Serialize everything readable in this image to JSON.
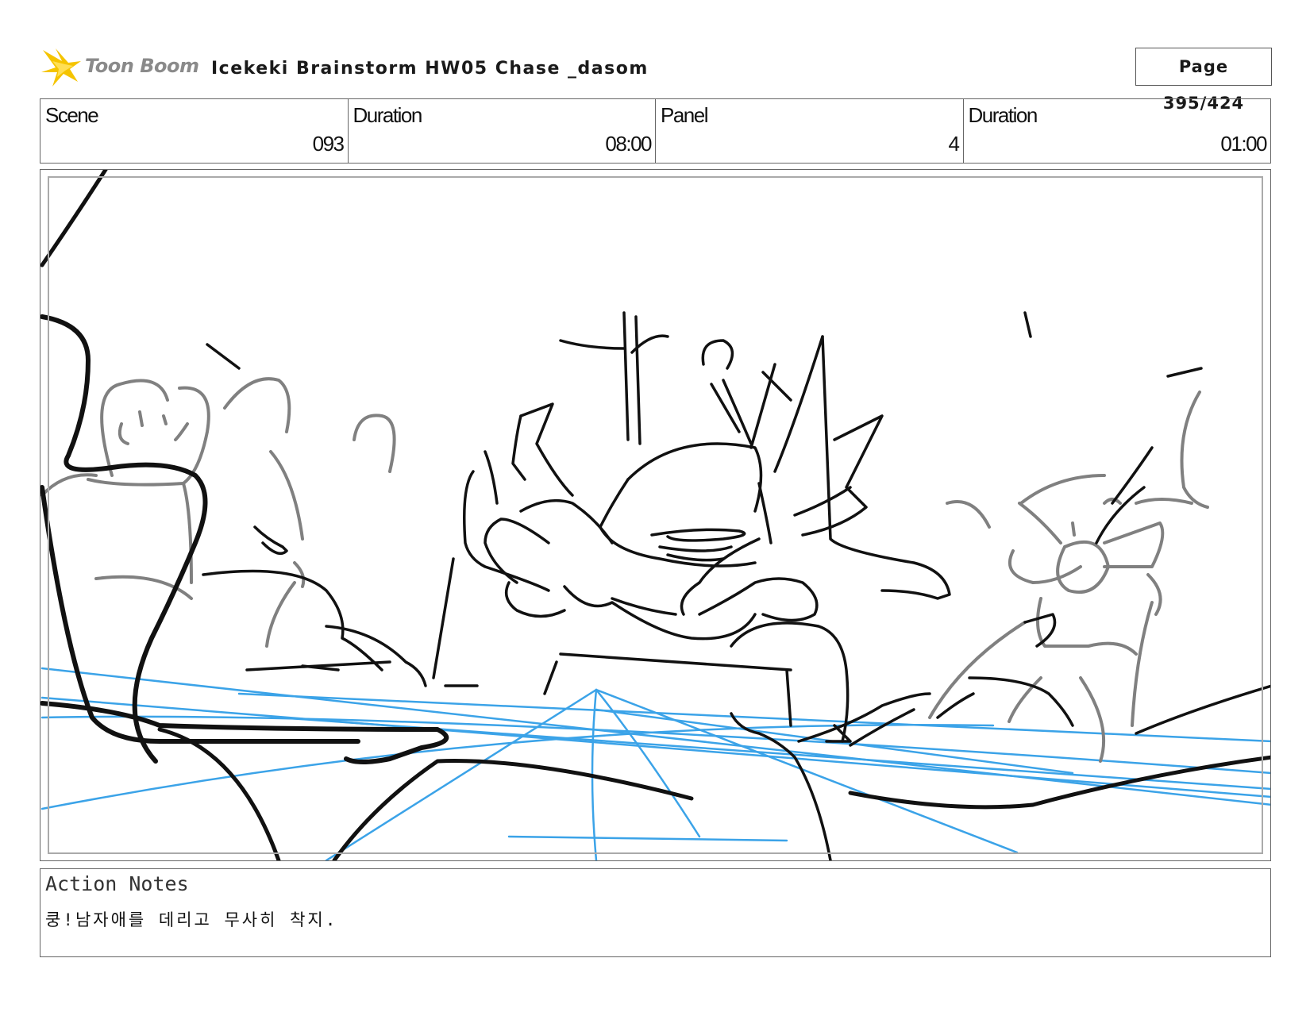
{
  "header": {
    "logo_text": "Toon Boom",
    "project_title": "Icekeki Brainstorm HW05 Chase _dasom",
    "page_label": "Page 395/424"
  },
  "info": {
    "scene_label": "Scene",
    "scene_value": "093",
    "scene_duration_label": "Duration",
    "scene_duration_value": "08:00",
    "panel_label": "Panel",
    "panel_value": "4",
    "panel_duration_label": "Duration",
    "panel_duration_value": "01:00"
  },
  "notes": {
    "label": "Action Notes",
    "text": "쿵!남자애를 데리고 무사히 착지."
  },
  "colors": {
    "ink": "#111111",
    "gray_ink": "#808080",
    "blue_ink": "#3ba3e8",
    "logo_yellow": "#f5c400"
  }
}
